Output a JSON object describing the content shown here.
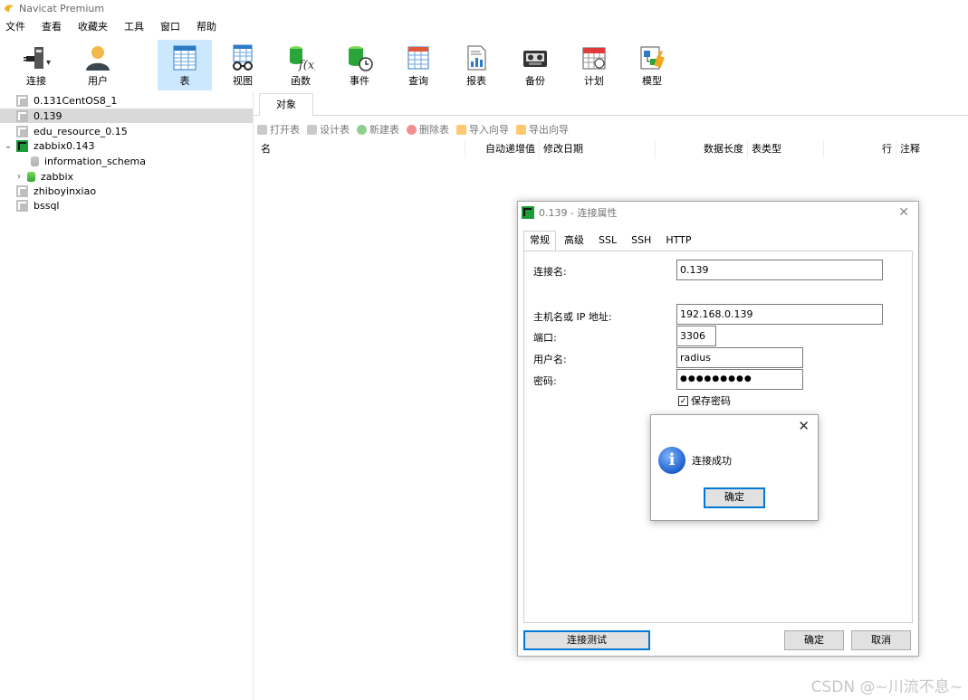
{
  "app": {
    "title": "Navicat Premium"
  },
  "menu": [
    "文件",
    "查看",
    "收藏夹",
    "工具",
    "窗口",
    "帮助"
  ],
  "toolbar": {
    "connect": "连接",
    "user": "用户",
    "table": "表",
    "view": "视图",
    "function": "函数",
    "event": "事件",
    "query": "查询",
    "report": "报表",
    "backup": "备份",
    "schedule": "计划",
    "model": "模型"
  },
  "tree": {
    "items": [
      "0.131CentOS8_1",
      "0.139",
      "edu_resource_0.15",
      "zabbix0.143",
      "information_schema",
      "zabbix",
      "zhiboyinxiao",
      "bssql"
    ],
    "selected": "0.139"
  },
  "objects_tab": "对象",
  "object_toolbar": [
    "打开表",
    "设计表",
    "新建表",
    "删除表",
    "导入向导",
    "导出向导"
  ],
  "columns": [
    "名",
    "自动递增值",
    "修改日期",
    "数据长度",
    "表类型",
    "行",
    "注释"
  ],
  "conn_dialog": {
    "title": "0.139 - 连接属性",
    "tabs": [
      "常规",
      "高级",
      "SSL",
      "SSH",
      "HTTP"
    ],
    "labels": {
      "conn_name": "连接名:",
      "host": "主机名或 IP 地址:",
      "port": "端口:",
      "username": "用户名:",
      "password": "密码:"
    },
    "values": {
      "conn_name": "0.139",
      "host": "192.168.0.139",
      "port": "3306",
      "username": "radius",
      "password": "●●●●●●●●●"
    },
    "save_password": "保存密码",
    "test_button": "连接测试",
    "ok_button": "确定",
    "cancel_button": "取消"
  },
  "message_box": {
    "text": "连接成功",
    "ok": "确定"
  },
  "watermark": "CSDN @~川流不息~"
}
